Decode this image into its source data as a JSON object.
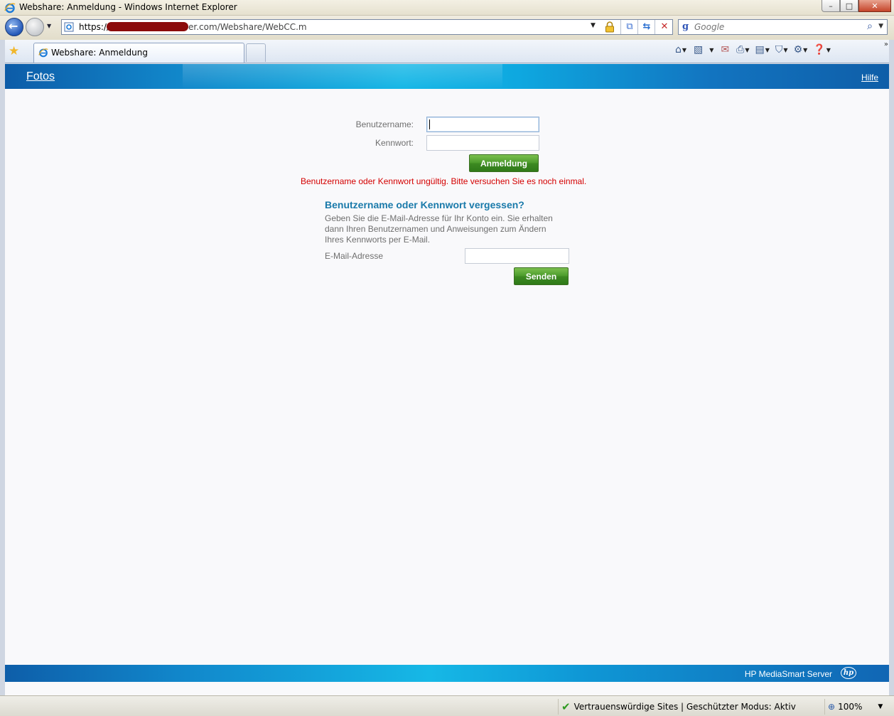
{
  "window": {
    "title": "Webshare: Anmeldung - Windows Internet Explorer",
    "min": "–",
    "max": "□",
    "close": "✕"
  },
  "address": {
    "url_prefix": "https://",
    "url_visible": "er.com/Webshare/WebCC.m",
    "dropdown_icon": "dropdown-icon",
    "lock_icon": "lock-icon"
  },
  "search": {
    "logo": "g",
    "placeholder": "Google"
  },
  "tab": {
    "label": "Webshare: Anmeldung"
  },
  "page": {
    "header": {
      "fotos": "Fotos",
      "hilfe": "Hilfe"
    },
    "login": {
      "username_label": "Benutzername:",
      "password_label": "Kennwort:",
      "username_value": "",
      "password_value": "",
      "submit": "Anmeldung",
      "error": "Benutzername oder Kennwort ungültig. Bitte versuchen Sie es noch einmal."
    },
    "forgot": {
      "title": "Benutzername oder Kennwort vergessen?",
      "description": "Geben Sie die E-Mail-Adresse für Ihr Konto ein. Sie erhalten dann Ihren Benutzernamen und Anweisungen zum Ändern Ihres Kennworts per E-Mail.",
      "email_label": "E-Mail-Adresse",
      "email_value": "",
      "submit": "Senden"
    },
    "footer": {
      "brand": "HP MediaSmart Server",
      "logo": "hp"
    }
  },
  "status": {
    "zone": "Vertrauenswürdige Sites | Geschützter Modus: Aktiv",
    "zoom": "100%"
  },
  "colors": {
    "accent_blue": "#16b7e6",
    "button_green": "#4a9a2a",
    "error_red": "#d40000",
    "title_blue": "#1a7aaa"
  }
}
